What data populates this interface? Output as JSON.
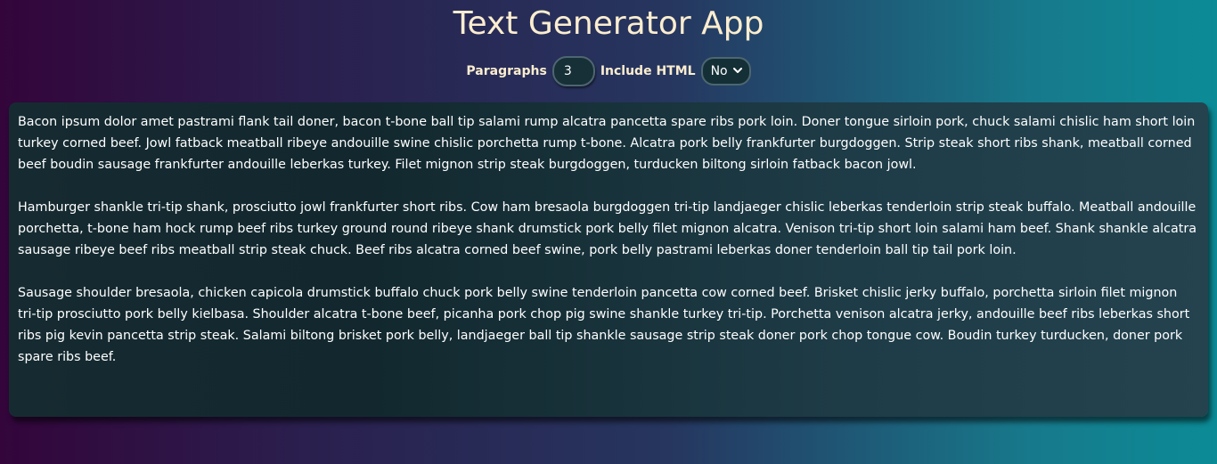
{
  "header": {
    "title": "Text Generator App"
  },
  "controls": {
    "paragraphs_label": "Paragraphs",
    "paragraphs_value": "3",
    "include_html_label": "Include HTML",
    "include_html_selected": "No",
    "include_html_icon": "chevron-down-icon"
  },
  "output": {
    "paragraphs": [
      "Bacon ipsum dolor amet pastrami flank tail doner, bacon t-bone ball tip salami rump alcatra pancetta spare ribs pork loin.  Doner tongue sirloin pork, chuck salami chislic ham short loin turkey corned beef.  Jowl fatback meatball ribeye andouille swine chislic porchetta rump t-bone.  Alcatra pork belly frankfurter burgdoggen.  Strip steak short ribs shank, meatball corned beef boudin sausage frankfurter andouille leberkas turkey.  Filet mignon strip steak burgdoggen, turducken biltong sirloin fatback bacon jowl.",
      "Hamburger shankle tri-tip shank, prosciutto jowl frankfurter short ribs.  Cow ham bresaola burgdoggen tri-tip landjaeger chislic leberkas tenderloin strip steak buffalo.  Meatball andouille porchetta, t-bone ham hock rump beef ribs turkey ground round ribeye shank drumstick pork belly filet mignon alcatra.  Venison tri-tip short loin salami ham beef.  Shank shankle alcatra sausage ribeye beef ribs meatball strip steak chuck.  Beef ribs alcatra corned beef swine, pork belly pastrami leberkas doner tenderloin ball tip tail pork loin.",
      "Sausage shoulder bresaola, chicken capicola drumstick buffalo chuck pork belly swine tenderloin pancetta cow corned beef.  Brisket chislic jerky buffalo, porchetta sirloin filet mignon tri-tip prosciutto pork belly kielbasa.  Shoulder alcatra t-bone beef, picanha pork chop pig swine shankle turkey tri-tip.  Porchetta venison alcatra jerky, andouille beef ribs leberkas short ribs pig kevin pancetta strip steak.  Salami biltong brisket pork belly, landjaeger ball tip shankle sausage strip steak doner pork chop tongue cow.  Boudin turkey turducken, doner pork spare ribs beef."
    ]
  }
}
